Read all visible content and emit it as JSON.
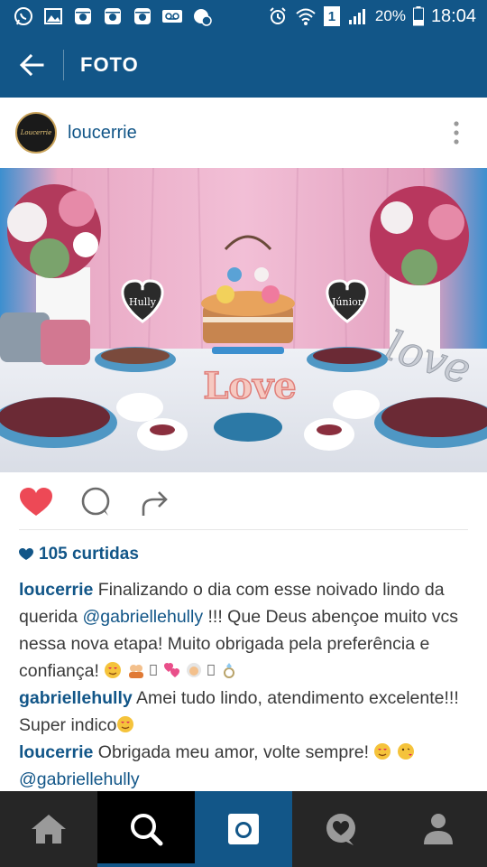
{
  "status_bar": {
    "battery_percent": "20%",
    "time": "18:04",
    "sim_label": "1"
  },
  "app_bar": {
    "title": "FOTO"
  },
  "post": {
    "username": "loucerrie",
    "avatar_text": "Loucerrie",
    "likes_text": "105 curtidas",
    "comments": [
      {
        "user": "loucerrie",
        "text_before_mention": " Finalizando o dia com esse noivado lindo da querida ",
        "mention": "@gabriellehully",
        "text_after_mention": " !!! Que Deus abençoe muito vcs nessa nova etapa! Muito obrigada pela preferência e confiança! "
      },
      {
        "user": "gabriellehully",
        "text": " Amei tudo lindo, atendimento excelente!!! Super indico"
      },
      {
        "user": "loucerrie",
        "text": " Obrigada meu amor, volte sempre! ",
        "mention": "@gabriellehully"
      }
    ]
  },
  "photo": {
    "cake_topper_left": "Hully",
    "cake_topper_right": "Júnior",
    "sign_text": "Love",
    "sign_right_text": "love"
  },
  "colors": {
    "brand": "#125688",
    "like_red": "#ed4956",
    "nav_bg": "#262626"
  },
  "icons": {
    "back": "arrow-left-icon",
    "more": "more-vertical-icon",
    "like": "heart-icon",
    "comment": "comment-icon",
    "share": "share-icon",
    "home": "home-icon",
    "search": "search-icon",
    "camera": "camera-icon",
    "activity": "heart-bubble-icon",
    "profile": "profile-icon"
  }
}
